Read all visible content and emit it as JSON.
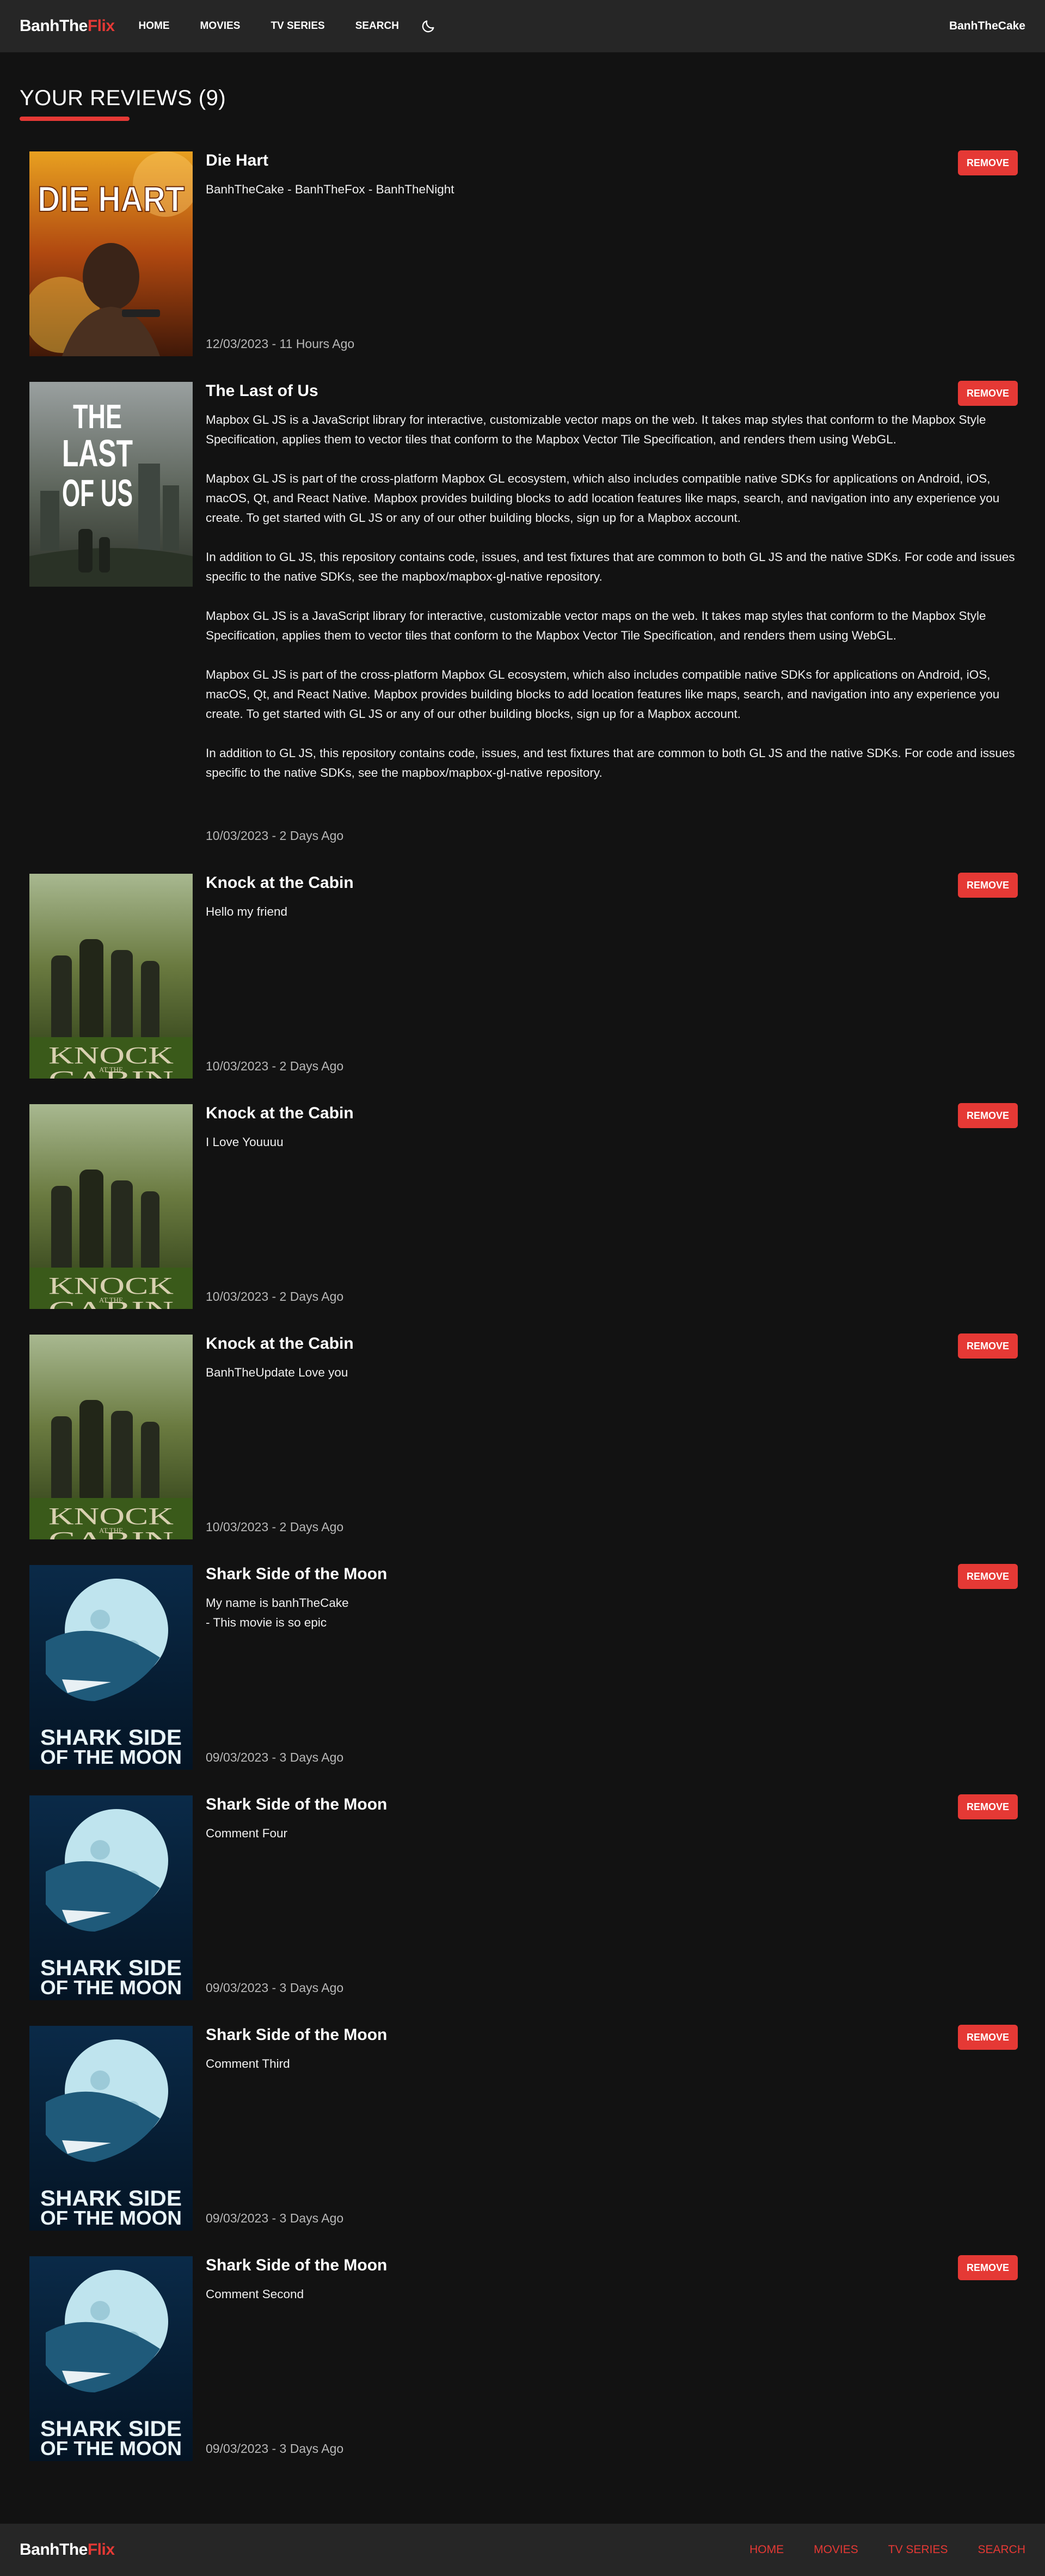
{
  "header": {
    "logo_main": "BanhThe",
    "logo_accent": "Flix",
    "nav": [
      "HOME",
      "MOVIES",
      "TV SERIES",
      "SEARCH"
    ],
    "user": "BanhTheCake"
  },
  "page": {
    "title": "YOUR REVIEWS (9)"
  },
  "reviews": [
    {
      "title": "Die Hart",
      "remove": "REMOVE",
      "content": [
        "BanhTheCake - BanhTheFox - BanhTheNight"
      ],
      "date": "12/03/2023 - 11 Hours Ago"
    },
    {
      "title": "The Last of Us",
      "remove": "REMOVE",
      "content": [
        "Mapbox GL JS is a JavaScript library for interactive, customizable vector maps on the web. It takes map styles that conform to the Mapbox Style Specification, applies them to vector tiles that conform to the Mapbox Vector Tile Specification, and renders them using WebGL.",
        "Mapbox GL JS is part of the cross-platform Mapbox GL ecosystem, which also includes compatible native SDKs for applications on Android, iOS, macOS, Qt, and React Native. Mapbox provides building blocks to add location features like maps, search, and navigation into any experience you create. To get started with GL JS or any of our other building blocks, sign up for a Mapbox account.",
        "In addition to GL JS, this repository contains code, issues, and test fixtures that are common to both GL JS and the native SDKs. For code and issues specific to the native SDKs, see the mapbox/mapbox-gl-native repository.",
        "Mapbox GL JS is a JavaScript library for interactive, customizable vector maps on the web. It takes map styles that conform to the Mapbox Style Specification, applies them to vector tiles that conform to the Mapbox Vector Tile Specification, and renders them using WebGL.",
        "Mapbox GL JS is part of the cross-platform Mapbox GL ecosystem, which also includes compatible native SDKs for applications on Android, iOS, macOS, Qt, and React Native. Mapbox provides building blocks to add location features like maps, search, and navigation into any experience you create. To get started with GL JS or any of our other building blocks, sign up for a Mapbox account.",
        "In addition to GL JS, this repository contains code, issues, and test fixtures that are common to both GL JS and the native SDKs. For code and issues specific to the native SDKs, see the mapbox/mapbox-gl-native repository."
      ],
      "date": "10/03/2023 - 2 Days Ago"
    },
    {
      "title": "Knock at the Cabin",
      "remove": "REMOVE",
      "content": [
        "Hello my friend"
      ],
      "date": "10/03/2023 - 2 Days Ago"
    },
    {
      "title": "Knock at the Cabin",
      "remove": "REMOVE",
      "content": [
        "I Love Youuuu"
      ],
      "date": "10/03/2023 - 2 Days Ago"
    },
    {
      "title": "Knock at the Cabin",
      "remove": "REMOVE",
      "content": [
        "BanhTheUpdate Love you"
      ],
      "date": "10/03/2023 - 2 Days Ago"
    },
    {
      "title": "Shark Side of the Moon",
      "remove": "REMOVE",
      "content": [
        "My name is banhTheCake",
        "- This movie is so epic"
      ],
      "date": "09/03/2023 - 3 Days Ago"
    },
    {
      "title": "Shark Side of the Moon",
      "remove": "REMOVE",
      "content": [
        "Comment Four"
      ],
      "date": "09/03/2023 - 3 Days Ago"
    },
    {
      "title": "Shark Side of the Moon",
      "remove": "REMOVE",
      "content": [
        "Comment Third"
      ],
      "date": "09/03/2023 - 3 Days Ago"
    },
    {
      "title": "Shark Side of the Moon",
      "remove": "REMOVE",
      "content": [
        "Comment Second"
      ],
      "date": "09/03/2023 - 3 Days Ago"
    }
  ],
  "posters": {
    "die_hart": [
      "DIE HART"
    ],
    "last_of_us": [
      "THE",
      "LAST",
      "OF US"
    ],
    "knock": [
      "KNOCK",
      "AT THE",
      "CABIN"
    ],
    "shark": [
      "SHARK SIDE",
      "OF THE MOON"
    ]
  },
  "footer": {
    "logo_main": "BanhThe",
    "logo_accent": "Flix",
    "nav": [
      "HOME",
      "MOVIES",
      "TV SERIES",
      "SEARCH"
    ]
  },
  "colors": {
    "background": "#121212",
    "bar": "#262626",
    "accent": "#e53935"
  }
}
